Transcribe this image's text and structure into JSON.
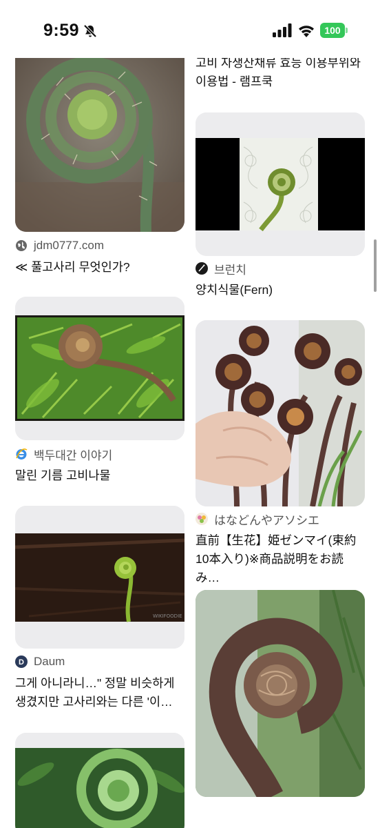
{
  "status_bar": {
    "time": "9:59",
    "battery": "100"
  },
  "left_column": [
    {
      "source": "jdm0777.com",
      "title": "≪ 풀고사리 무엇인가?",
      "image": "fern fiddlehead with fuzzy scales"
    },
    {
      "source": "백두대간 이야기",
      "title": "말린 기름 고비나물",
      "image": "brown fiddlehead over green fern leaves"
    },
    {
      "source": "Daum",
      "title": "그게 아니라니…\" 정말 비슷하게 생겼지만 고사리와는 다른 '이…",
      "image": "small green fiddlehead on dark background"
    },
    {
      "image": "green coiled fern frond"
    }
  ],
  "right_column": [
    {
      "title": "고비 자생산채류 효능 이용부위와 이용법 - 램프쿡",
      "image": "cut-off result"
    },
    {
      "source": "브런치",
      "title": "양치식물(Fern)",
      "image": "fern fiddlehead illustration on lace background"
    },
    {
      "source": "はなどんやアソシエ",
      "title": "直前【生花】姫ゼンマイ(束約10本入り)※商品説明をお読み…",
      "image": "hand holding bunch of zenmai fiddleheads"
    },
    {
      "image": "large brown fuzzy fiddlehead close-up"
    }
  ],
  "icons": {
    "globe": "globe-icon",
    "brunch": "brunch-icon",
    "ie": "ie-icon",
    "daum": "daum-icon",
    "flower": "flower-icon"
  }
}
